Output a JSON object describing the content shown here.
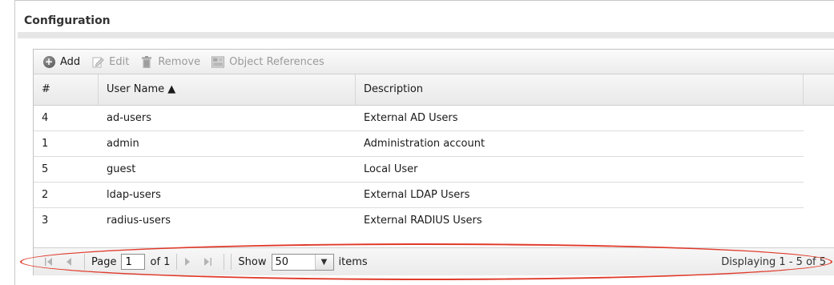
{
  "section": {
    "title": "Configuration"
  },
  "toolbar": {
    "add_label": "Add",
    "edit_label": "Edit",
    "remove_label": "Remove",
    "object_refs_label": "Object References"
  },
  "table": {
    "columns": [
      "#",
      "User Name ▲",
      "Description"
    ],
    "rows": [
      {
        "num": "4",
        "user": "ad-users",
        "desc": "External AD Users"
      },
      {
        "num": "1",
        "user": "admin",
        "desc": "Administration account"
      },
      {
        "num": "5",
        "user": "guest",
        "desc": "Local User"
      },
      {
        "num": "2",
        "user": "ldap-users",
        "desc": "External LDAP Users"
      },
      {
        "num": "3",
        "user": "radius-users",
        "desc": "External RADIUS Users"
      }
    ]
  },
  "pager": {
    "page_label": "Page",
    "page_value": "1",
    "of_label": "of 1",
    "show_label": "Show",
    "show_value": "50",
    "items_label": "items",
    "displaying": "Displaying 1 - 5 of 5"
  },
  "colors": {
    "highlight_ellipse": "#e03a2a"
  }
}
